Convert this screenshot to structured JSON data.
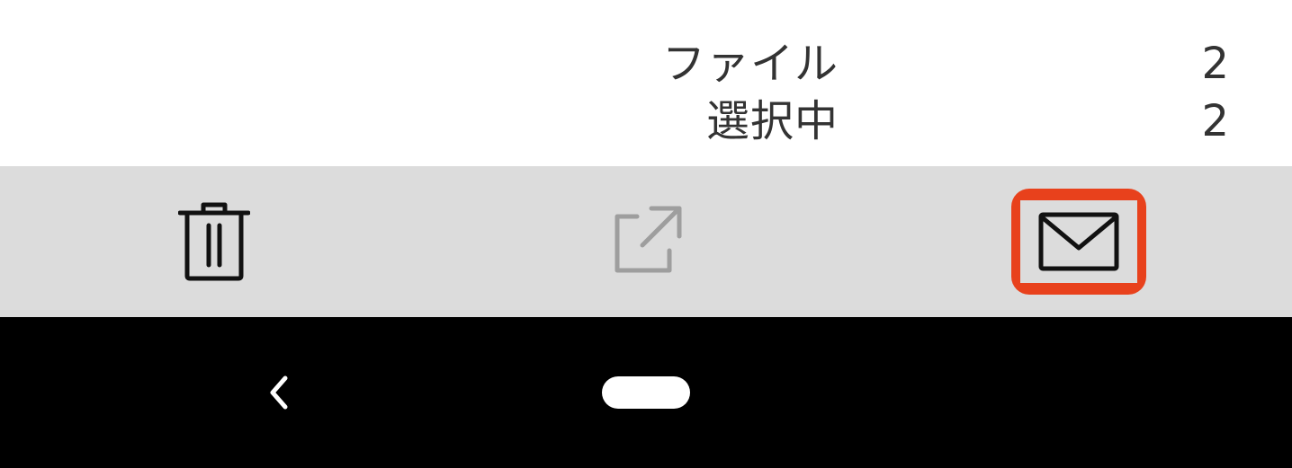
{
  "summary": {
    "files_label": "ファイル",
    "files_count": "2",
    "selected_label": "選択中",
    "selected_count": "2"
  },
  "toolbar": {
    "delete_icon": "trash-icon",
    "share_icon": "open-external-icon",
    "mail_icon": "mail-icon",
    "highlight_color": "#e8411c",
    "share_disabled_color": "#9e9e9e"
  },
  "navbar": {
    "back_icon": "chevron-left-icon",
    "home_icon": "home-pill-icon"
  }
}
